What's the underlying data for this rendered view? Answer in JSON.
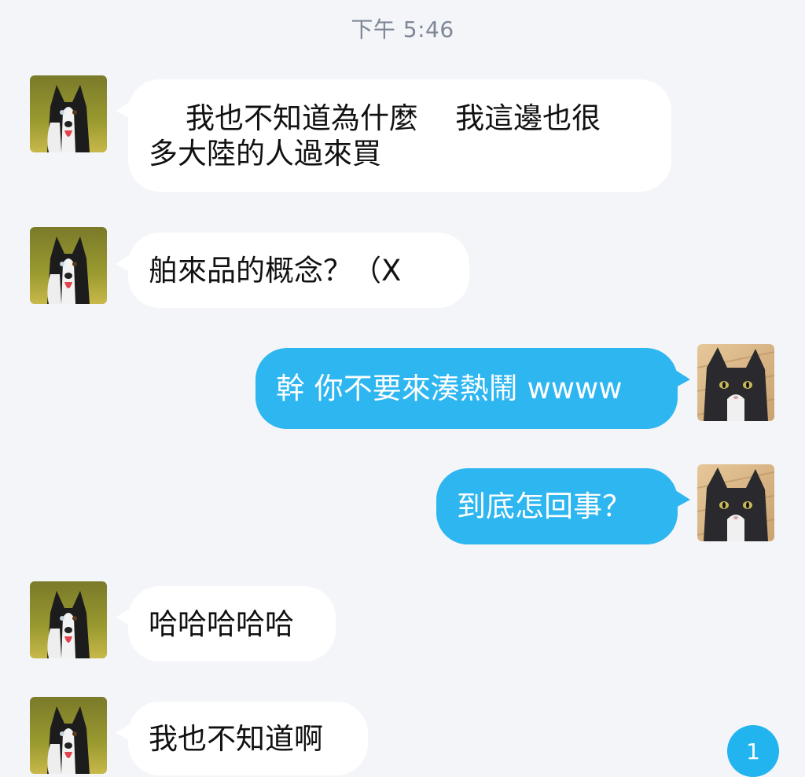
{
  "chat": {
    "timestamp": "下午 5:46",
    "messages": [
      {
        "direction": "incoming",
        "sender_avatar": "dog-avatar",
        "text": "    我也不知道為什麼    我這邊也很\n多大陸的人過來買"
      },
      {
        "direction": "incoming",
        "sender_avatar": "dog-avatar",
        "text": "舶來品的概念？（X"
      },
      {
        "direction": "outgoing",
        "sender_avatar": "cat-avatar",
        "text": "幹 你不要來湊熱鬧 wwww"
      },
      {
        "direction": "outgoing",
        "sender_avatar": "cat-avatar",
        "text": "到底怎回事？"
      },
      {
        "direction": "incoming",
        "sender_avatar": "dog-avatar",
        "text": "哈哈哈哈哈"
      },
      {
        "direction": "incoming",
        "sender_avatar": "dog-avatar",
        "text": "我也不知道啊"
      }
    ],
    "unread_count": "1"
  },
  "colors": {
    "background": "#f3f5f9",
    "incoming_bubble": "#ffffff",
    "outgoing_bubble": "#2eb6f0",
    "badge": "#21b4ee",
    "timestamp_text": "#7f8796"
  }
}
